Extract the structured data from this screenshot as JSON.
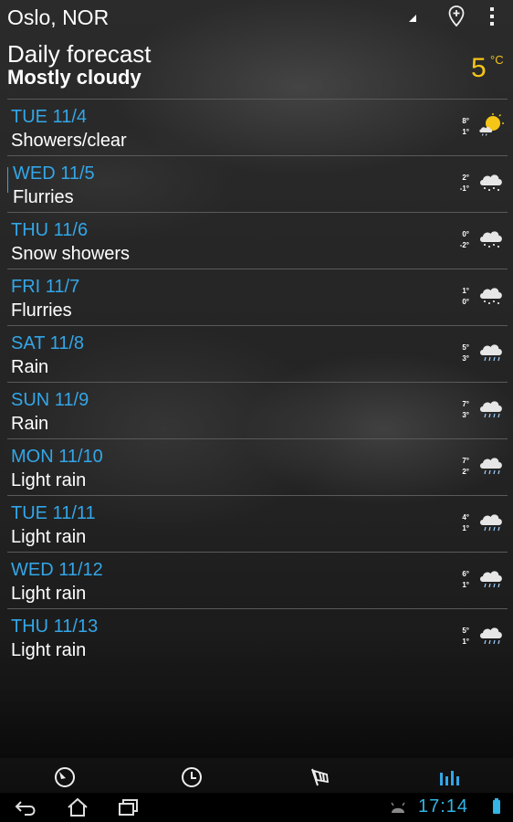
{
  "header": {
    "city": "Oslo, NOR",
    "title": "Daily forecast",
    "condition": "Mostly cloudy",
    "temp": "5",
    "temp_unit": "°C"
  },
  "forecast": [
    {
      "day": "TUE 11/4",
      "desc": "Showers/clear",
      "hi": "8°",
      "lo": "1°",
      "icon": "sun-cloud-icon"
    },
    {
      "day": "WED 11/5",
      "desc": "Flurries",
      "hi": "2°",
      "lo": "-1°",
      "icon": "snow-cloud-icon"
    },
    {
      "day": "THU 11/6",
      "desc": "Snow showers",
      "hi": "0°",
      "lo": "-2°",
      "icon": "snow-cloud-icon"
    },
    {
      "day": "FRI 11/7",
      "desc": "Flurries",
      "hi": "1°",
      "lo": "0°",
      "icon": "snow-cloud-icon"
    },
    {
      "day": "SAT 11/8",
      "desc": "Rain",
      "hi": "5°",
      "lo": "3°",
      "icon": "rain-cloud-icon"
    },
    {
      "day": "SUN 11/9",
      "desc": "Rain",
      "hi": "7°",
      "lo": "3°",
      "icon": "rain-cloud-icon"
    },
    {
      "day": "MON 11/10",
      "desc": "Light rain",
      "hi": "7°",
      "lo": "2°",
      "icon": "rain-cloud-icon"
    },
    {
      "day": "TUE 11/11",
      "desc": "Light rain",
      "hi": "4°",
      "lo": "1°",
      "icon": "rain-cloud-icon"
    },
    {
      "day": "WED 11/12",
      "desc": "Light rain",
      "hi": "6°",
      "lo": "1°",
      "icon": "rain-cloud-icon"
    },
    {
      "day": "THU 11/13",
      "desc": "Light rain",
      "hi": "5°",
      "lo": "1°",
      "icon": "rain-cloud-icon"
    }
  ],
  "tabs": [
    {
      "icon": "gauge-icon",
      "active": false
    },
    {
      "icon": "clock-icon",
      "active": false
    },
    {
      "icon": "windsock-icon",
      "active": false
    },
    {
      "icon": "bar-chart-icon",
      "active": true
    }
  ],
  "system": {
    "time": "17:14"
  },
  "colors": {
    "accent": "#33a6e8",
    "temp": "#f5c518",
    "divider": "#5a5a5a"
  }
}
